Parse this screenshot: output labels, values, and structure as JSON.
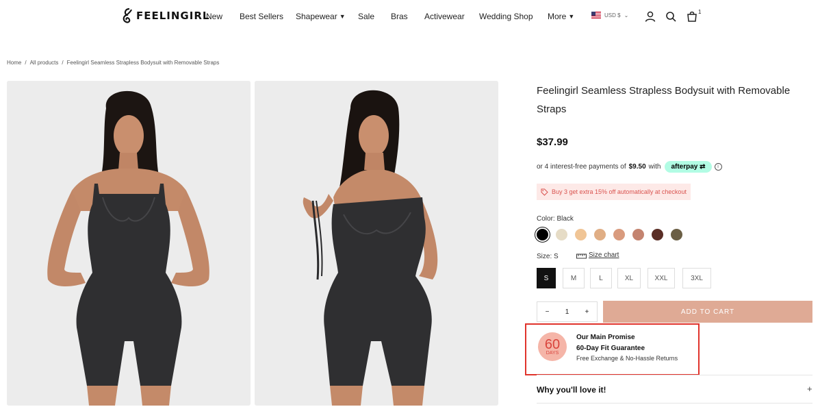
{
  "header": {
    "logo_text": "FEELINGIRL",
    "nav": [
      {
        "label": "New"
      },
      {
        "label": "Best Sellers"
      },
      {
        "label": "Shapewear"
      },
      {
        "label": "Sale"
      },
      {
        "label": "Bras"
      },
      {
        "label": "Activewear"
      },
      {
        "label": "Wedding Shop"
      },
      {
        "label": "More"
      }
    ],
    "currency": "USD $",
    "cart_count": "1",
    "icons": [
      "account-icon",
      "search-icon",
      "cart-icon"
    ]
  },
  "breadcrumb": [
    "Home",
    "All products",
    "Feelingirl Seamless Strapless Bodysuit with Removable Straps"
  ],
  "product": {
    "title": "Feelingirl Seamless Strapless Bodysuit with Removable Straps",
    "price": "$37.99",
    "installment_prefix": "or 4 interest-free payments of",
    "installment_amount": "$9.50",
    "installment_with": "with",
    "afterpay_label": "afterpay",
    "promo": "Buy 3 get extra 15% off automatically at checkout",
    "color_label": "Color: Black",
    "swatches": [
      "#000000",
      "#e6dcc6",
      "#f0c596",
      "#e0ae85",
      "#d99b7e",
      "#c48470",
      "#5a2e26",
      "#6b5f45"
    ],
    "size_label": "Size: S",
    "size_chart": "Size chart",
    "sizes": [
      "S",
      "M",
      "L",
      "XL",
      "XXL",
      "3XL"
    ],
    "selected_size": "S",
    "quantity": "1",
    "qty_minus": "−",
    "qty_plus": "+",
    "add_to_cart": "ADD TO CART"
  },
  "promise": {
    "badge_number": "60",
    "badge_unit": "DAYS",
    "title": "Our Main Promise",
    "subtitle": "60-Day Fit Guarantee",
    "description": "Free Exchange & No-Hassle Returns"
  },
  "accordion": {
    "title": "Why you'll love it!",
    "icon": "+"
  },
  "colors": {
    "accent": "#dfaa95",
    "promo_text": "#d9534f",
    "promo_bg": "#fde9e7",
    "afterpay": "#b2fce4",
    "highlight_border": "#e0332b"
  }
}
